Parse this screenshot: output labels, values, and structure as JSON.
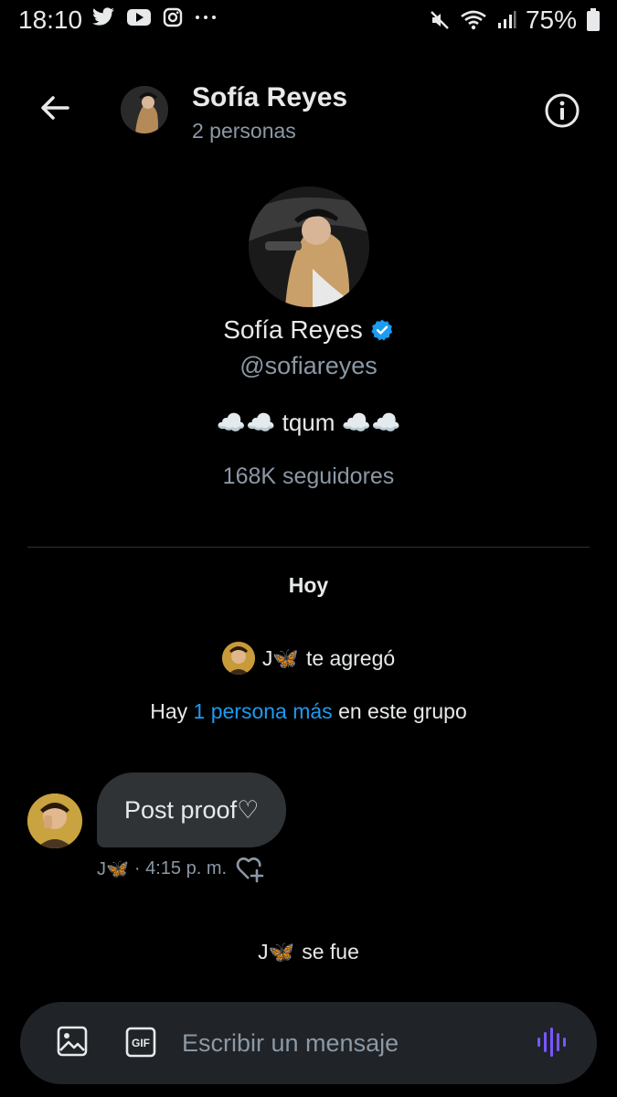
{
  "status_bar": {
    "time": "18:10",
    "battery": "75%"
  },
  "header": {
    "title": "Sofía Reyes",
    "subtitle": "2 personas"
  },
  "profile": {
    "name": "Sofía Reyes",
    "handle": "@sofiareyes",
    "bio": "☁️☁️ tqum ☁️☁️",
    "followers": "168K seguidores"
  },
  "chat": {
    "day_label": "Hoy",
    "added_user": "J🦋",
    "added_text": "te agregó",
    "group_info": {
      "before": "Hay ",
      "link": "1 persona más",
      "after": " en este grupo"
    },
    "message": {
      "text": "Post proof♡",
      "sender": "J🦋",
      "time": "· 4:15 p. m."
    },
    "left_user": "J🦋",
    "left_text": "se fue"
  },
  "composer": {
    "placeholder": "Escribir un mensaje",
    "gif_label": "GIF"
  },
  "colors": {
    "accent": "#1d9bf0",
    "voice": "#7856ff",
    "bubble": "#2f3336",
    "muted": "#8b98a5"
  }
}
